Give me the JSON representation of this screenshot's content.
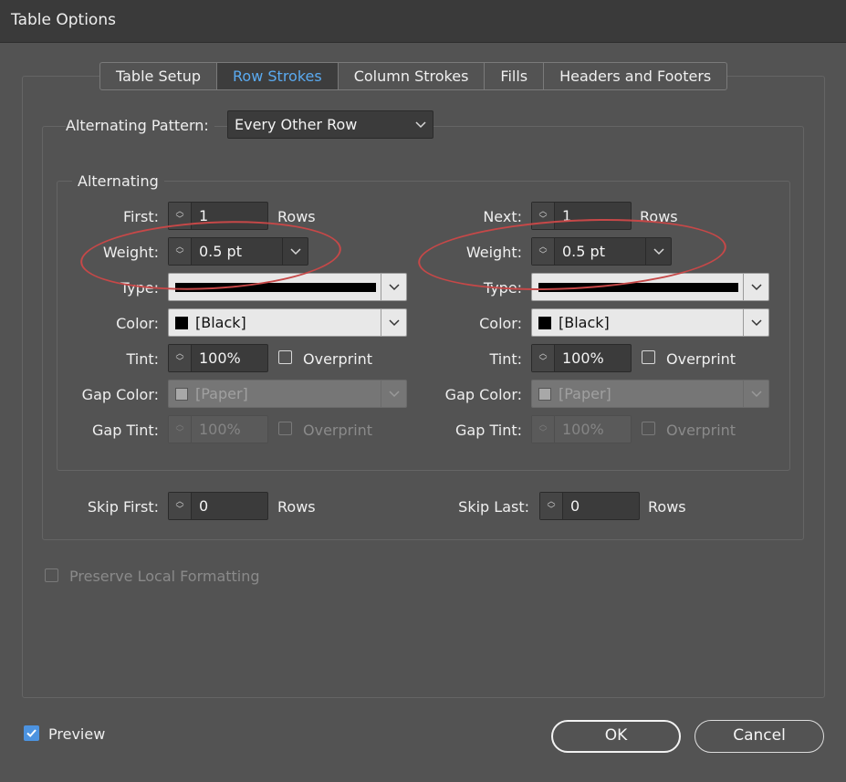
{
  "window": {
    "title": "Table Options"
  },
  "tabs": [
    {
      "label": "Table Setup",
      "active": false
    },
    {
      "label": "Row Strokes",
      "active": true
    },
    {
      "label": "Column Strokes",
      "active": false
    },
    {
      "label": "Fills",
      "active": false
    },
    {
      "label": "Headers and Footers",
      "active": false
    }
  ],
  "pattern": {
    "label": "Alternating Pattern:",
    "value": "Every Other Row"
  },
  "alternating": {
    "legend": "Alternating",
    "first": {
      "count_label": "First:",
      "count_value": "1",
      "count_unit": "Rows",
      "weight_label": "Weight:",
      "weight_value": "0.5 pt",
      "type_label": "Type:",
      "color_label": "Color:",
      "color_value": "[Black]",
      "tint_label": "Tint:",
      "tint_value": "100%",
      "overprint_label": "Overprint",
      "gap_color_label": "Gap Color:",
      "gap_color_value": "[Paper]",
      "gap_tint_label": "Gap Tint:",
      "gap_tint_value": "100%",
      "gap_overprint_label": "Overprint"
    },
    "next": {
      "count_label": "Next:",
      "count_value": "1",
      "count_unit": "Rows",
      "weight_label": "Weight:",
      "weight_value": "0.5 pt",
      "type_label": "Type:",
      "color_label": "Color:",
      "color_value": "[Black]",
      "tint_label": "Tint:",
      "tint_value": "100%",
      "overprint_label": "Overprint",
      "gap_color_label": "Gap Color:",
      "gap_color_value": "[Paper]",
      "gap_tint_label": "Gap Tint:",
      "gap_tint_value": "100%",
      "gap_overprint_label": "Overprint"
    }
  },
  "skip": {
    "first_label": "Skip First:",
    "first_value": "0",
    "first_unit": "Rows",
    "last_label": "Skip Last:",
    "last_value": "0",
    "last_unit": "Rows"
  },
  "preserve_local_formatting": {
    "label": "Preserve Local Formatting",
    "checked": false
  },
  "preview": {
    "label": "Preview",
    "checked": true
  },
  "buttons": {
    "ok": "OK",
    "cancel": "Cancel"
  },
  "colors": {
    "accent": "#5aaaf0",
    "annotation": "#c64848",
    "checkbox_checked": "#4c93e0"
  }
}
